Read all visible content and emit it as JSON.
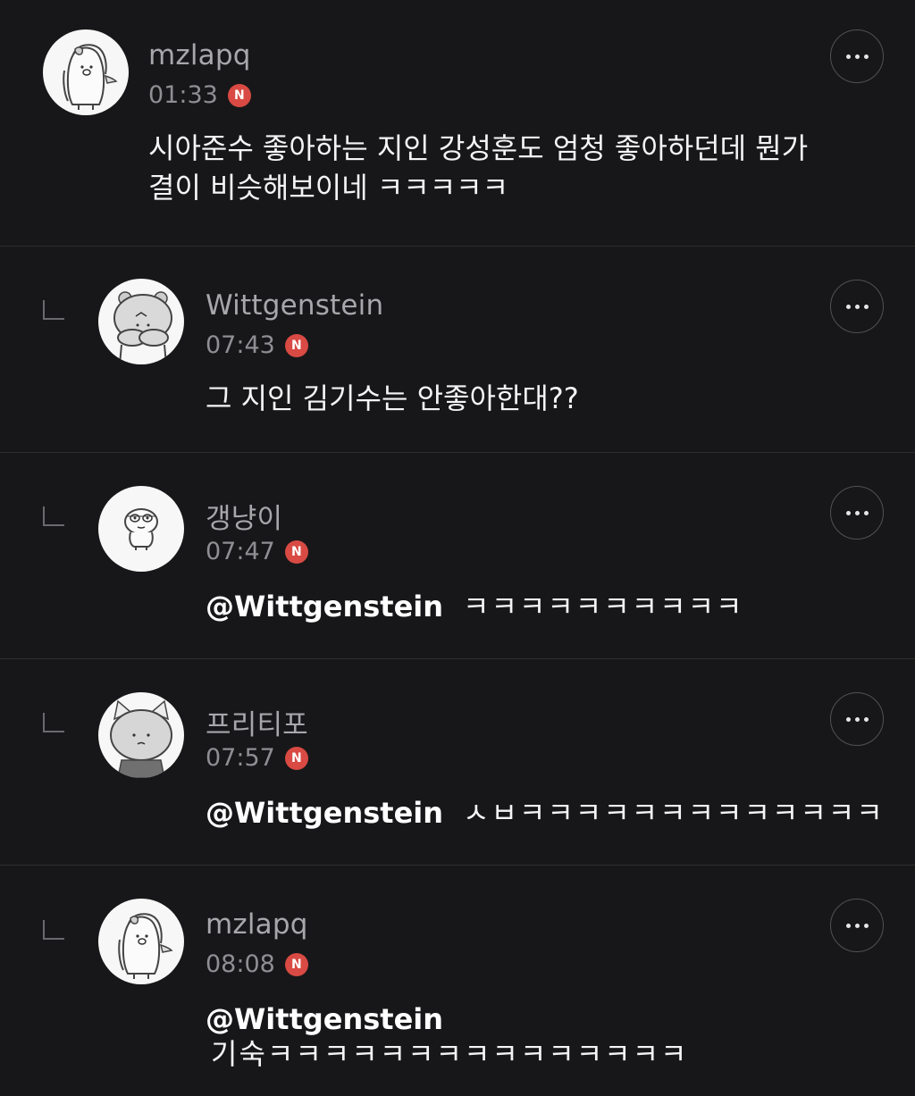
{
  "comments": [
    {
      "author": "mzlapq",
      "time": "01:33",
      "badge": "N",
      "text": "시아준수 좋아하는 지인 강성훈도 엄청 좋아하던데 뭔가\n결이 비슷해보이네 ㅋㅋㅋㅋㅋ",
      "avatar_icon": "pig-character-icon",
      "is_reply": false
    },
    {
      "author": "Wittgenstein",
      "time": "07:43",
      "badge": "N",
      "text": "그 지인 김기수는 안좋아한대??",
      "avatar_icon": "bear-character-icon",
      "is_reply": true
    },
    {
      "author": "갱냥이",
      "time": "07:47",
      "badge": "N",
      "mention": "@Wittgenstein",
      "text": "ㅋㅋㅋㅋㅋㅋㅋㅋㅋㅋ",
      "avatar_icon": "goggle-character-icon",
      "is_reply": true
    },
    {
      "author": "프리티포",
      "time": "07:57",
      "badge": "N",
      "mention": "@Wittgenstein",
      "text": "ㅅㅂㅋㅋㅋㅋㅋㅋㅋㅋㅋㅋㅋㅋㅋ",
      "avatar_icon": "cat-character-icon",
      "is_reply": true
    },
    {
      "author": "mzlapq",
      "time": "08:08",
      "badge": "N",
      "mention": "@Wittgenstein",
      "text": "기숙ㅋㅋㅋㅋㅋㅋㅋㅋㅋㅋㅋㅋㅋㅋㅋ",
      "avatar_icon": "pig-character-icon",
      "is_reply": true
    }
  ],
  "colors": {
    "background": "#171719",
    "badge": "#d84a43",
    "author": "#a7a7ab",
    "time": "#8f8f93",
    "divider": "#2e2e31"
  },
  "icons": {
    "more": "more-icon",
    "reply": "reply-arrow-icon",
    "badge": "new-badge-icon"
  }
}
